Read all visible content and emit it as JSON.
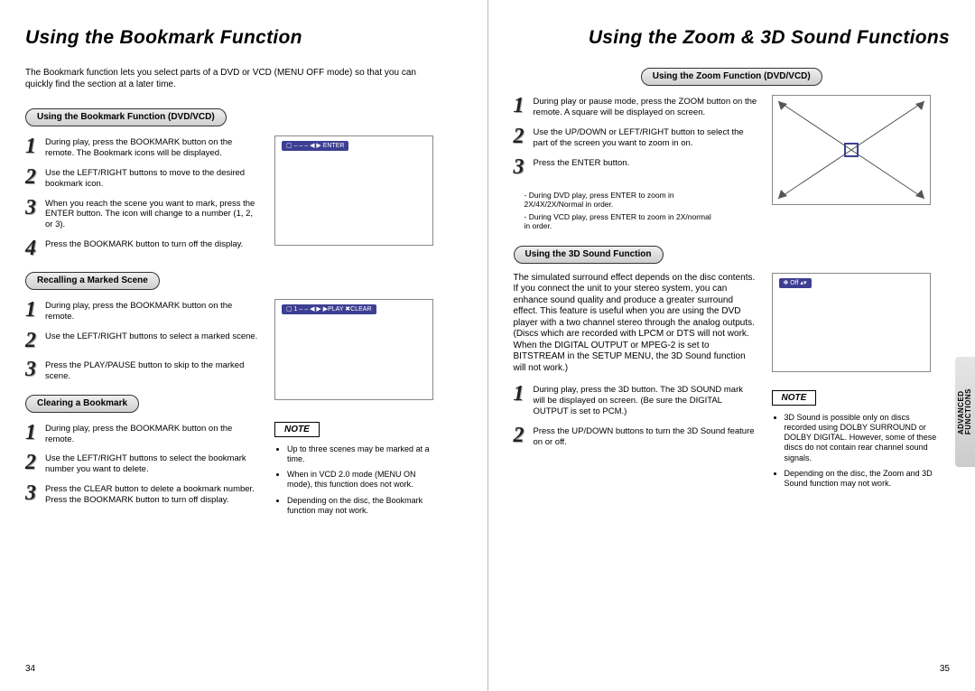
{
  "left": {
    "title": "Using the Bookmark Function",
    "intro": "The Bookmark function lets you select parts of a DVD or VCD (MENU OFF mode) so that you can quickly find the section at a later time.",
    "section1": {
      "pill": "Using the Bookmark Function (DVD/VCD)",
      "steps": [
        "During play, press the BOOKMARK button on the remote. The Bookmark icons will be displayed.",
        "Use the LEFT/RIGHT buttons to move to the desired bookmark icon.",
        "When you reach the scene you want to mark, press the ENTER button. The icon will change to a number (1, 2, or 3).",
        "Press the BOOKMARK button to turn off the display."
      ],
      "osd": "▢ –  –  –  ◀ ▶ ENTER"
    },
    "section2": {
      "pill": "Recalling a Marked Scene",
      "steps": [
        "During play, press the BOOKMARK button on the remote.",
        "Use the LEFT/RIGHT buttons to select a marked scene.",
        "Press the PLAY/PAUSE button to skip to the marked scene."
      ],
      "osd": "▢ 1  –  –  ◀ ▶ ▶PLAY ✖CLEAR"
    },
    "section3": {
      "pill": "Clearing a Bookmark",
      "steps": [
        "During play, press the BOOKMARK button on the remote.",
        "Use the LEFT/RIGHT buttons to select the bookmark number you want to delete.",
        "Press the CLEAR button to delete a bookmark number. Press the BOOKMARK button to turn off display."
      ],
      "note_label": "NOTE",
      "notes": [
        "Up to three scenes may be marked at a time.",
        "When in VCD 2.0 mode (MENU ON mode), this function does not work.",
        "Depending on the disc, the Bookmark function may not work."
      ]
    },
    "pageno": "34"
  },
  "right": {
    "title": "Using the Zoom & 3D Sound Functions",
    "section1": {
      "pill": "Using the Zoom Function (DVD/VCD)",
      "steps": [
        "During play or pause mode, press the ZOOM button on the remote. A square will be displayed on screen.",
        "Use the UP/DOWN or LEFT/RIGHT button to select the part of the screen you want to zoom in on.",
        "Press the ENTER button."
      ],
      "subnotes": [
        "During DVD play, press ENTER to zoom in 2X/4X/2X/Normal in order.",
        "During VCD play, press ENTER to zoom in 2X/normal in order."
      ]
    },
    "section2": {
      "pill": "Using the 3D Sound Function",
      "intro": "The simulated surround effect depends on the disc contents. If you connect the unit to your stereo system, you can enhance sound quality and produce a greater surround effect. This feature is useful when you are using the DVD player with a two channel stereo through the analog outputs. (Discs which are recorded with LPCM or DTS will not work. When the DIGITAL OUTPUT or MPEG-2 is set to BITSTREAM in the SETUP MENU, the 3D Sound function will not work.)",
      "steps": [
        "During play, press the 3D button. The 3D SOUND mark will be displayed on screen. (Be sure the DIGITAL OUTPUT is set to PCM.)",
        "Press the UP/DOWN buttons to turn the 3D Sound feature on or off."
      ],
      "osd": "❋  Off ▴▾",
      "note_label": "NOTE",
      "notes": [
        "3D Sound is possible only on discs recorded using DOLBY SURROUND or DOLBY DIGITAL. However, some of these discs do not contain rear channel sound signals.",
        "Depending on the disc, the Zoom and 3D Sound function may not work."
      ]
    },
    "pageno": "35",
    "sidetab": "ADVANCED\nFUNCTIONS"
  }
}
